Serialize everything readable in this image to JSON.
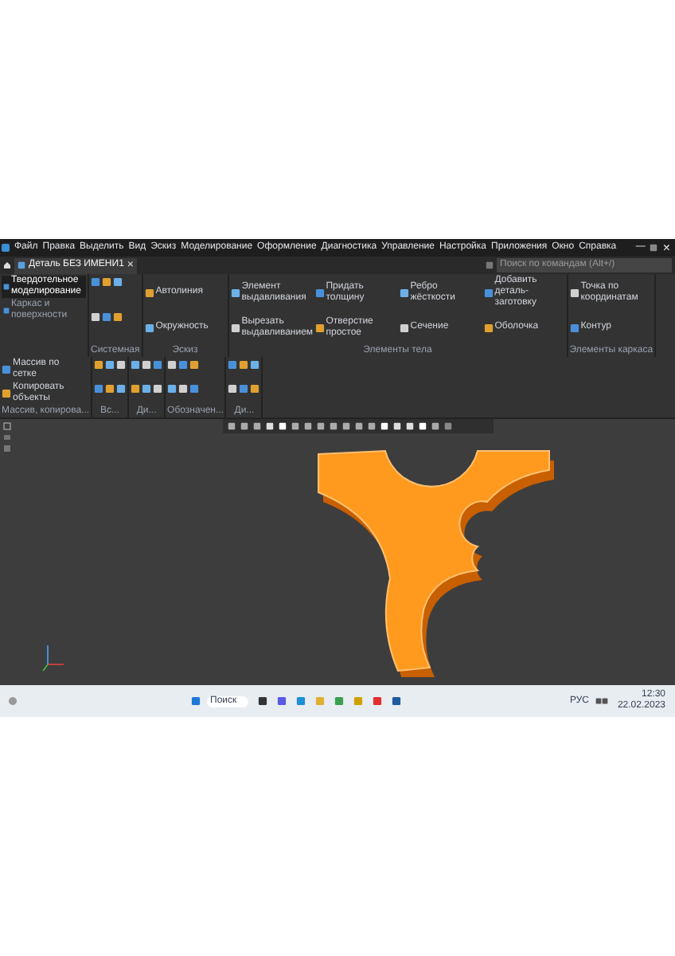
{
  "menu": [
    "Файл",
    "Правка",
    "Выделить",
    "Вид",
    "Эскиз",
    "Моделирование",
    "Оформление",
    "Диагностика",
    "Управление",
    "Настройка",
    "Приложения",
    "Окно",
    "Справка"
  ],
  "search": {
    "placeholder": "Поиск по командам (Alt+/)"
  },
  "window_controls": {
    "minimize": "—",
    "close": "×"
  },
  "tab": {
    "title": "Деталь БЕЗ ИМЕНИ1",
    "close": "×"
  },
  "modes": [
    {
      "label": "Твердотельное моделирование",
      "selected": true
    },
    {
      "label": "Каркас и поверхности",
      "selected": false
    }
  ],
  "ribbon_groups": [
    {
      "kind": "icons",
      "label": "Системная"
    },
    {
      "kind": "text",
      "label": "Эскиз",
      "items": [
        "Автолиния",
        "Окружность"
      ]
    },
    {
      "kind": "text",
      "label": "Элементы тела",
      "items": [
        "Элемент выдавливания",
        "Вырезать выдавливанием",
        "Придать толщину",
        "Отверстие простое",
        "Ребро жёсткости",
        "Сечение",
        "Добавить деталь-заготовку",
        "Оболочка"
      ]
    },
    {
      "kind": "text",
      "label": "Элементы каркаса",
      "items": [
        "Точка по координатам",
        "Контур"
      ]
    },
    {
      "kind": "text",
      "label": "Массив, копирова...",
      "items": [
        "Массив по сетке",
        "Копировать объекты"
      ]
    },
    {
      "kind": "icons",
      "label": "Вс..."
    },
    {
      "kind": "icons",
      "label": "Ди..."
    },
    {
      "kind": "icons",
      "label": "Обозначен..."
    },
    {
      "kind": "icons",
      "label": "Ди..."
    }
  ],
  "taskbar": {
    "search": "Поиск",
    "language": "РУС",
    "time": "12:30",
    "date": "22.02.2023"
  }
}
